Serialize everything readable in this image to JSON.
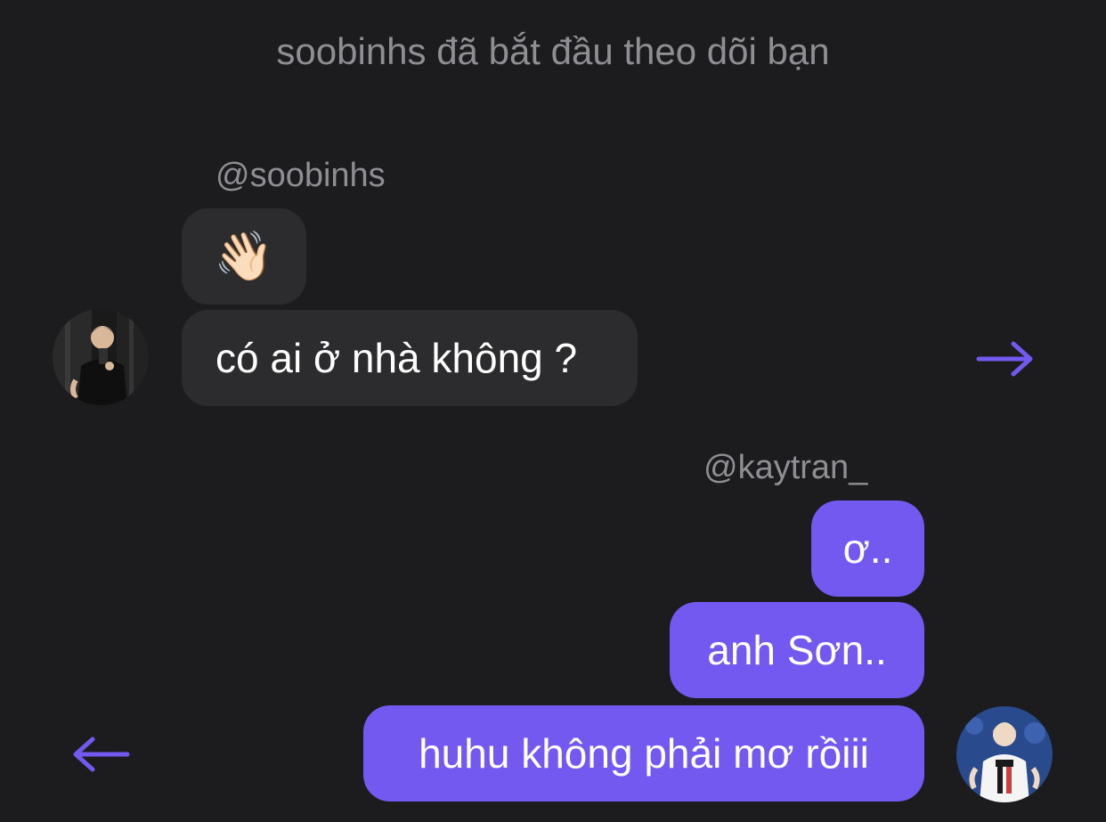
{
  "notice": {
    "text": "soobinhs đã bắt đầu theo dõi bạn"
  },
  "incoming": {
    "username": "@soobinhs",
    "messages": [
      {
        "text": "👋🏻",
        "kind": "emoji"
      },
      {
        "text": "có ai ở nhà không ?"
      }
    ],
    "avatar_icon": "person-photo-avatar",
    "arrow_icon": "arrow-right-icon"
  },
  "outgoing": {
    "username": "@kaytran_",
    "messages": [
      {
        "text": "ơ.."
      },
      {
        "text": "anh Sơn.."
      },
      {
        "text": "huhu không phải mơ rồiii"
      }
    ],
    "avatar_icon": "person-photo-avatar",
    "arrow_icon": "arrow-left-icon"
  },
  "colors": {
    "background": "#1c1c1e",
    "incoming_bubble": "#2c2c2e",
    "outgoing_bubble": "#7359f0",
    "muted_text": "#8e8e93",
    "accent": "#7359f0"
  }
}
